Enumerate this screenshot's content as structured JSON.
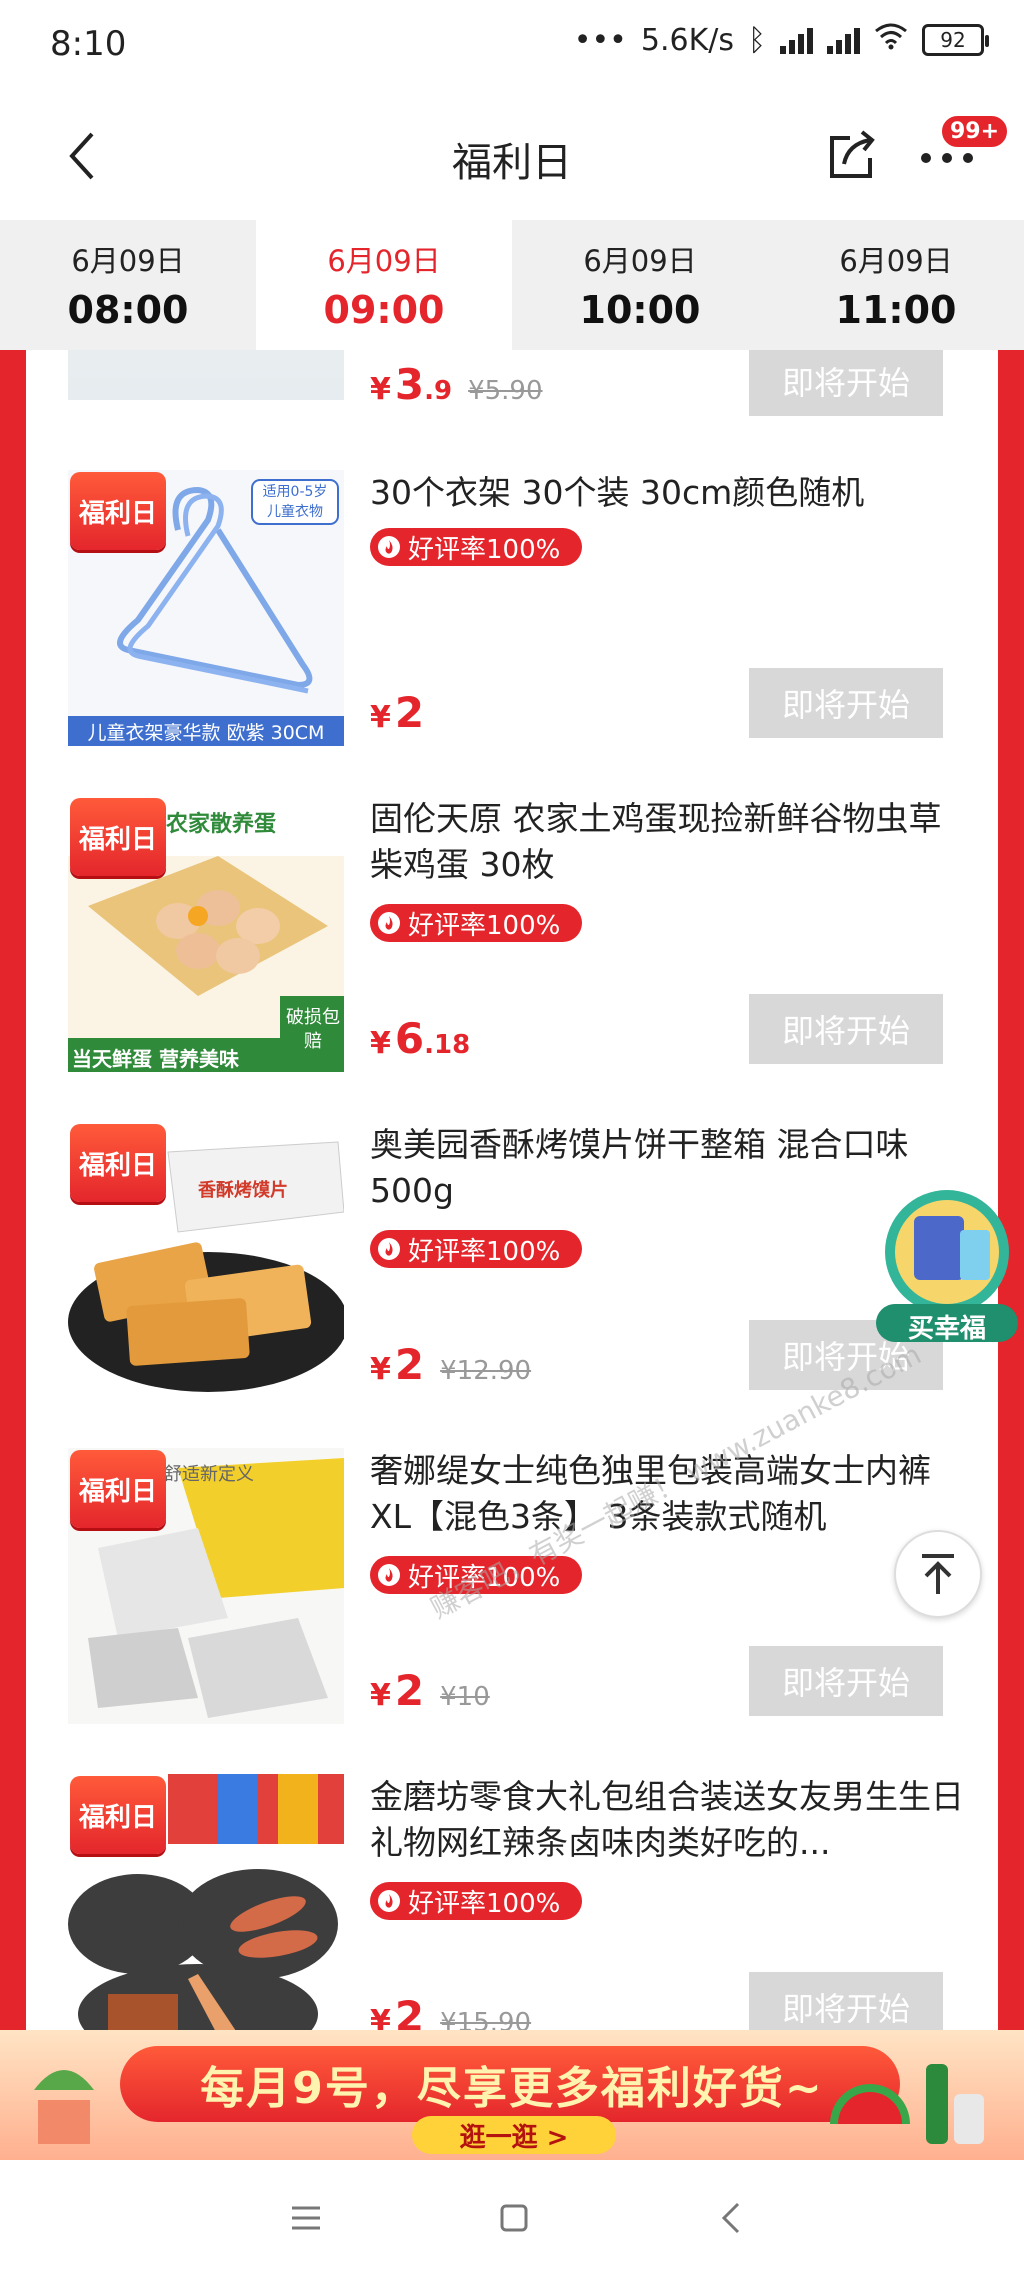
{
  "status_bar": {
    "time": "8:10",
    "network_speed": "5.6K/s",
    "battery": "92"
  },
  "nav": {
    "title": "福利日",
    "badge": "99+"
  },
  "tabs": [
    {
      "date": "6月09日",
      "time": "08:00",
      "active": false
    },
    {
      "date": "6月09日",
      "time": "09:00",
      "active": true
    },
    {
      "date": "6月09日",
      "time": "10:00",
      "active": false
    },
    {
      "date": "6月09日",
      "time": "11:00",
      "active": false
    }
  ],
  "tag_label": "福利日",
  "rating_label": "好评率100%",
  "button_label": "即将开始",
  "products": [
    {
      "title": "",
      "price_int": "3",
      "price_dec": ".9",
      "original_price": "¥5.90"
    },
    {
      "title": "30个衣架 30个装 30cm颜色随机",
      "price_int": "2",
      "price_dec": "",
      "original_price": ""
    },
    {
      "title": "固伦天原 农家土鸡蛋现捡新鲜谷物虫草柴鸡蛋 30枚",
      "price_int": "6",
      "price_dec": ".18",
      "original_price": ""
    },
    {
      "title": "奥美园香酥烤馍片饼干整箱 混合口味500g",
      "price_int": "2",
      "price_dec": "",
      "original_price": "¥12.90"
    },
    {
      "title": "奢娜缇女士纯色独里包装高端女士内裤 XL【混色3条】 3条装款式随机",
      "price_int": "2",
      "price_dec": "",
      "original_price": "¥10"
    },
    {
      "title": "金磨坊零食大礼包组合装送女友男生生日礼物网红辣条卤味肉类好吃的...",
      "price_int": "2",
      "price_dec": "",
      "original_price": "¥15.90"
    }
  ],
  "thumb_captions": {
    "hanger_note": "适用0-5岁 儿童衣物",
    "hanger_bottom": "儿童衣架豪华款 欧紫 30CM",
    "egg_top": "农家散养蛋",
    "egg_bottom": "当天鲜蛋 营养美味",
    "egg_side": "破损包赔",
    "snack_box": "香酥烤馍片",
    "underwear_top": "舒适新定义"
  },
  "float_promo_label": "买幸福",
  "watermark": "赚客吧，有奖一起赚！ www.zuanke8.com",
  "banner": {
    "text": "每月9号，尽享更多福利好货~",
    "button": "逛一逛 >"
  },
  "colors": {
    "accent": "#e4262c",
    "disabled_button": "#d8d8d8"
  }
}
